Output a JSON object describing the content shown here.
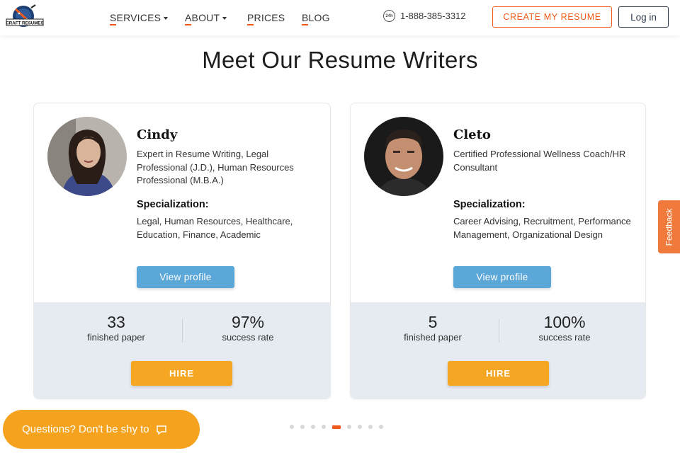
{
  "brand": {
    "logo_text": "CRAFT RESUMES"
  },
  "nav": {
    "items": [
      {
        "label": "SERVICES",
        "has_dropdown": true
      },
      {
        "label": "ABOUT",
        "has_dropdown": true
      },
      {
        "label": "PRICES",
        "has_dropdown": false
      },
      {
        "label": "BLOG",
        "has_dropdown": false
      }
    ]
  },
  "header": {
    "phone_badge": "24h",
    "phone": "1-888-385-3312",
    "create_label": "CREATE MY RESUME",
    "login_label": "Log in"
  },
  "page_title": "Meet Our Resume Writers",
  "writers": [
    {
      "name": "Cindy",
      "role": "Expert in Resume Writing, Legal Professional (J.D.), Human Resources Professional (M.B.A.)",
      "specialization_label": "Specialization:",
      "specialization": "Legal, Human Resources, Healthcare, Education, Finance, Academic",
      "view_label": "View profile",
      "finished_value": "33",
      "finished_label": "finished paper",
      "success_value": "97%",
      "success_label": "success rate",
      "hire_label": "HIRE"
    },
    {
      "name": "Cleto",
      "role": "Certified Professional Wellness Coach/HR Consultant",
      "specialization_label": "Specialization:",
      "specialization": "Career Advising, Recruitment, Performance Management, Organizational Design",
      "view_label": "View profile",
      "finished_value": "5",
      "finished_label": "finished paper",
      "success_value": "100%",
      "success_label": "success rate",
      "hire_label": "HIRE"
    }
  ],
  "carousel": {
    "total_dots": 9,
    "active_index": 4
  },
  "feedback_label": "Feedback",
  "chat_label": "Questions? Don't be shy to",
  "colors": {
    "accent": "#f05a1a",
    "view_button": "#5aa7d8",
    "hire_button": "#f5a623",
    "stats_bg": "#e5ebf1",
    "chat_bg": "#f5a31f",
    "feedback_bg": "#f07a3c"
  },
  "icons": [
    "logo-icon",
    "caret-down-icon",
    "phone-24h-icon",
    "chat-bubble-icon"
  ]
}
